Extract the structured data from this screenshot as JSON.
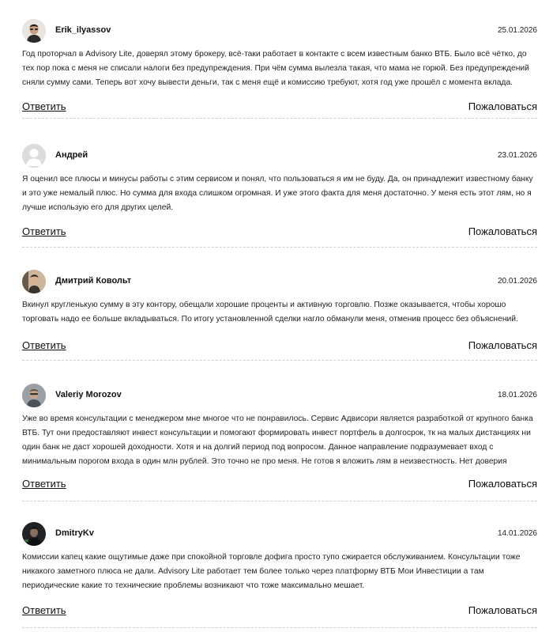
{
  "reviews": [
    {
      "author": "Erik_ilyassov",
      "date": "25.01.2026",
      "text": "Год проторчал в Advisory Lite, доверял этому брокеру, всё-таки работает в контакте с всем известным банко ВТБ. Было всё чётко, до тех пор пока с меня не списали налоги без предупреждения. При чём сумма вылезла такая, что мама не горюй. Без предупреждений сняли сумму сами. Теперь вот хочу вывести деньги, так с меня ещё и комиссию требуют, хотя год уже прошёл с момента вклада.",
      "avatar": "photo-man-dark-icon"
    },
    {
      "author": "Андрей",
      "date": "23.01.2026",
      "text": "Я оценил все плюсы и минусы работы с этим сервисом и понял, что пользоваться я им не буду. Да, он принадлежит известному банку и это уже немалый плюс. Но сумма для входа слишком огромная. И уже этого факта для меня достаточно. У меня есть этот лям, но я лучше использую его для других целей.",
      "avatar": "default-user-icon"
    },
    {
      "author": "Дмитрий Ковольт",
      "date": "20.01.2026",
      "text": "Вкинул кругленькую сумму в эту контору, обещали хорошие проценты и активную торговлю. Позже оказывается, чтобы хорошо торговать надо ее больше вкладываться. По итогу установленной сделки нагло обманули меня, отменив процесс без объяснений.",
      "avatar": "photo-man-beige-icon"
    },
    {
      "author": "Valeriy Morozov",
      "date": "18.01.2026",
      "text": "Уже во время консультации с менеджером мне многое что не понравилось. Сервис Адвисори является разработкой от крупного банка ВТБ. Тут они предоставляют инвест консультации и помогают формировать инвест портфель в долгосрок, тк на малых дистанциях ни один банк не даст хорошей доходности. Хотя и на долгий период под вопросом. Данное направление подразумевает вход с минимальным порогом входа в один млн рублей. Это точно не про меня. Не готов я вложить лям в неизвестность. Нет доверия",
      "avatar": "photo-man-grey-icon"
    },
    {
      "author": "DmitryKv",
      "date": "14.01.2026",
      "text": "Комиссии капец какие ощутимые даже при спокойной торговле дофига просто тупо сжирается обслуживанием. Консультации тоже никакого заметного плюса не дали. Advisory Lite работает тем более только через платформу ВТБ Мои Инвестиции а там периодические какие то технические проблемы возникают что тоже максимально мешает.",
      "avatar": "photo-man-black-icon"
    }
  ],
  "actions": {
    "reply_label": "Ответить",
    "complain_label": "Пожаловаться"
  }
}
